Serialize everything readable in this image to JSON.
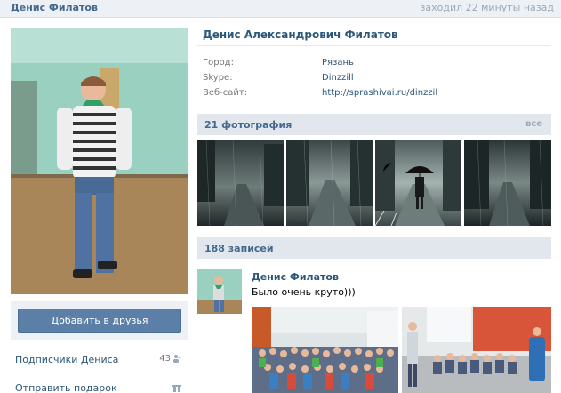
{
  "header": {
    "name": "Денис Филатов",
    "status": "заходил 22 минуты назад"
  },
  "profile": {
    "full_name": "Денис Александрович Филатов",
    "info": [
      {
        "key": "Город:",
        "value": "Рязань"
      },
      {
        "key": "Skype:",
        "value": "Dinzzill"
      },
      {
        "key": "Веб-сайт:",
        "value": "http://sprashivai.ru/dinzzil"
      }
    ]
  },
  "sidebar": {
    "add_friend": "Добавить в друзья",
    "followers_label": "Подписчики Дениса",
    "followers_count": "43",
    "gift_label": "Отправить подарок"
  },
  "photos": {
    "title": "21 фотография",
    "all": "все"
  },
  "wall": {
    "title": "188 записей",
    "post": {
      "author": "Денис Филатов",
      "text": "Было очень круто)))"
    }
  }
}
